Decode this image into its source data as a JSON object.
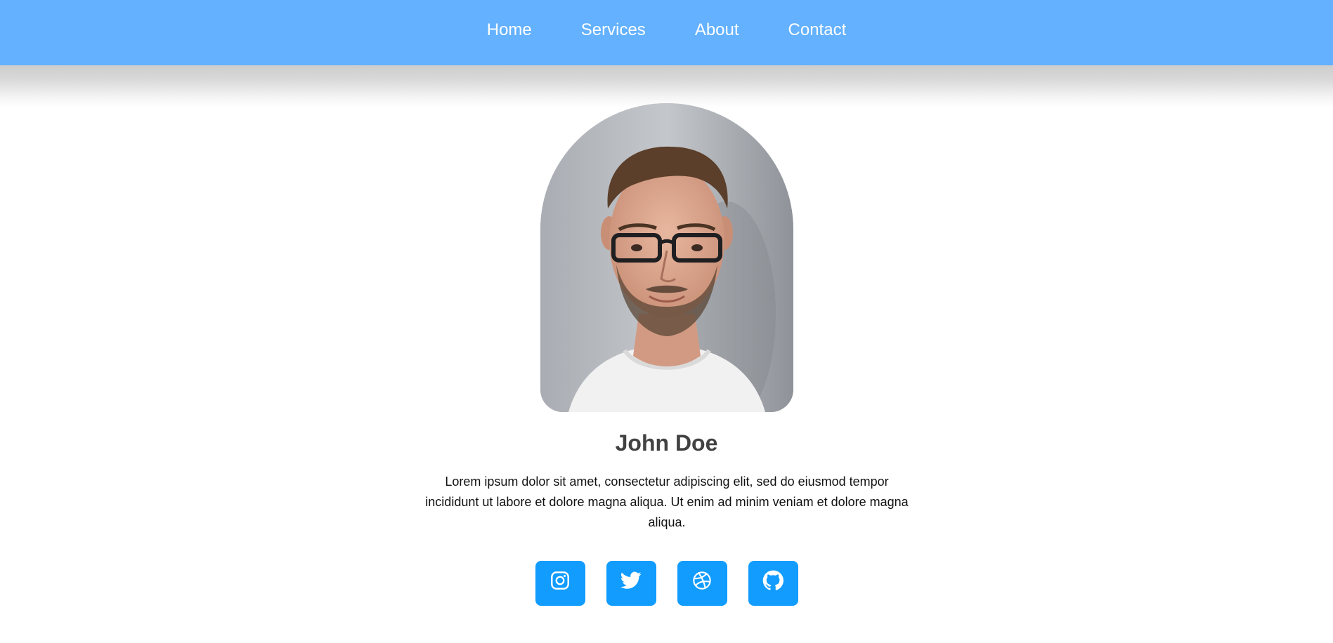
{
  "nav": {
    "items": [
      {
        "label": "Home"
      },
      {
        "label": "Services"
      },
      {
        "label": "About"
      },
      {
        "label": "Contact"
      }
    ]
  },
  "profile": {
    "name": "John Doe",
    "bio": "Lorem ipsum dolor sit amet, consectetur adipiscing elit, sed do eiusmod tempor incididunt ut labore et dolore magna aliqua. Ut enim ad minim veniam et dolore magna aliqua."
  },
  "socials": [
    {
      "icon": "instagram-icon"
    },
    {
      "icon": "twitter-icon"
    },
    {
      "icon": "dribbble-icon"
    },
    {
      "icon": "github-icon"
    }
  ],
  "colors": {
    "navbar": "#63b1ff",
    "social_button": "#119cfe",
    "name_text": "#414141"
  }
}
